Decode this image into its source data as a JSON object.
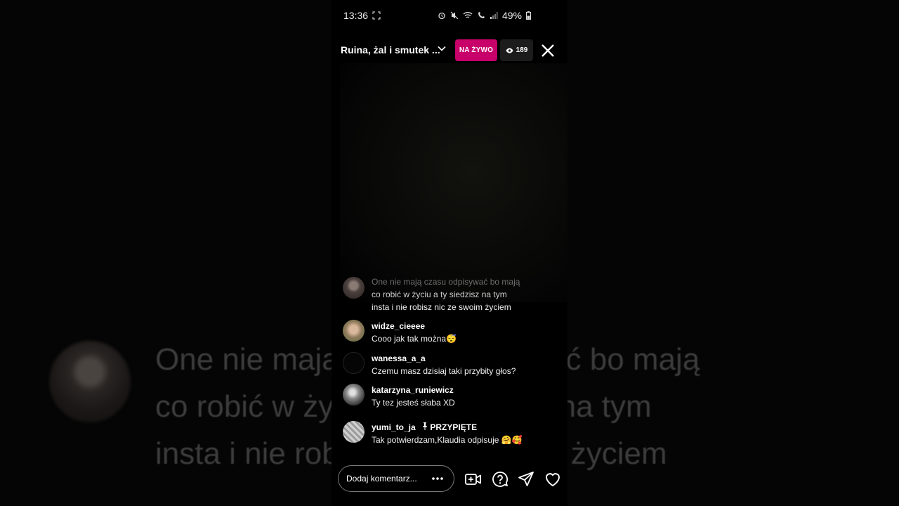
{
  "status_bar": {
    "time": "13:36",
    "battery": "49%"
  },
  "header": {
    "title": "Ruina, żal i smutek ...",
    "live_badge": "NA ŻYWO",
    "viewer_count": "189"
  },
  "background_echo": {
    "lines": [
      "One nie mają czasu odpisywać bo mają",
      "co robić w życiu a ty siedzisz na tym",
      "insta i nie robisz nic ze swoim życiem"
    ]
  },
  "comments": [
    {
      "user": "",
      "lines": [
        "One nie mają czasu odpisywać bo mają",
        "co robić w życiu a ty siedzisz na tym",
        "insta i nie robisz nic ze swoim życiem"
      ]
    },
    {
      "user": "widze_cieeee",
      "text": "Cooo jak tak można😴"
    },
    {
      "user": "wanessa_a_a",
      "text": "Czemu masz dzisiaj taki przybity głos?"
    },
    {
      "user": "katarzyna_runiewicz",
      "text": "Ty tez jesteś słaba XD"
    },
    {
      "user": "yumi_to_ja",
      "pinned": "PRZYPIĘTE",
      "text": "Tak potwierdzam,Klaudia odpisuje 🤗🥰"
    }
  ],
  "input": {
    "placeholder": "Dodaj komentarz..."
  },
  "icons": [
    "chevron-down-icon",
    "eye-icon",
    "close-icon",
    "more-icon",
    "add-video-icon",
    "question-icon",
    "send-icon",
    "heart-icon",
    "pin-icon"
  ]
}
